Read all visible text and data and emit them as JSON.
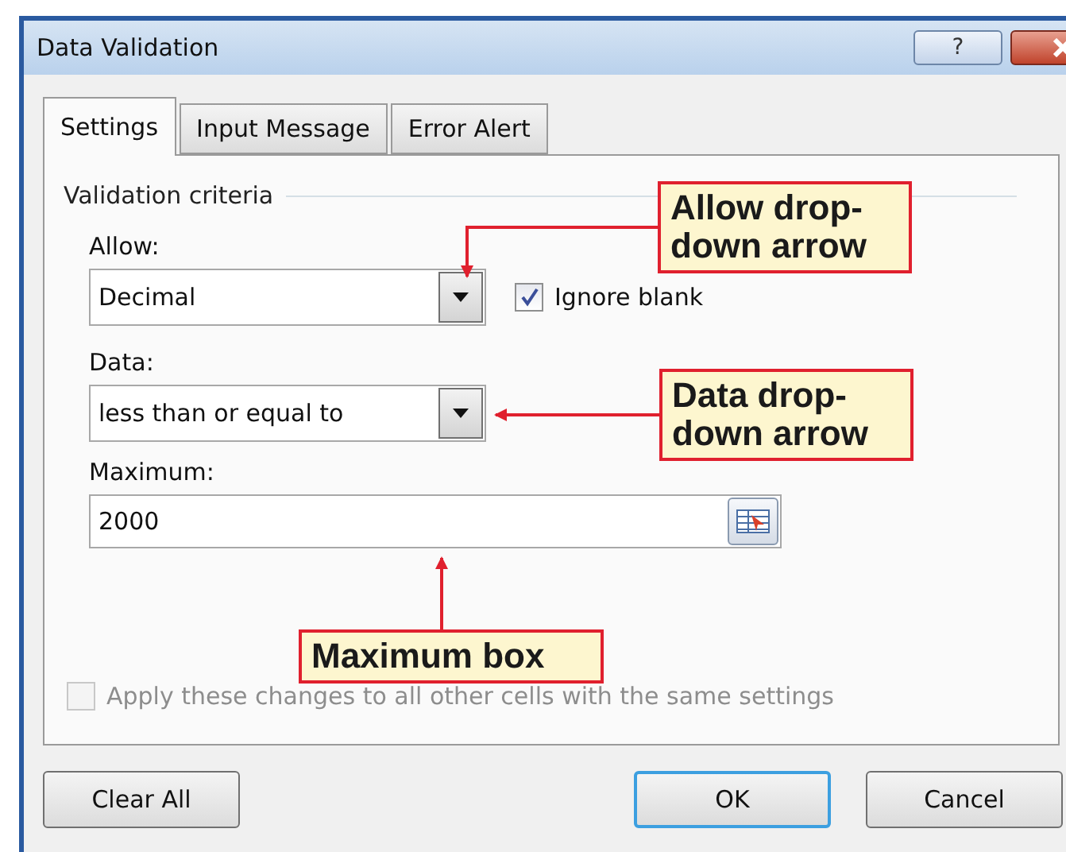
{
  "window": {
    "title": "Data Validation",
    "help": "?"
  },
  "tabs": [
    {
      "label": "Settings",
      "selected": true
    },
    {
      "label": "Input Message",
      "selected": false
    },
    {
      "label": "Error Alert",
      "selected": false
    }
  ],
  "group_title": "Validation criteria",
  "allow": {
    "label": "Allow:",
    "value": "Decimal"
  },
  "ignore_blank": {
    "label": "Ignore blank",
    "checked": true
  },
  "data": {
    "label": "Data:",
    "value": "less than or equal to"
  },
  "maximum": {
    "label": "Maximum:",
    "value": "2000"
  },
  "apply_all": {
    "label": "Apply these changes to all other cells with the same settings",
    "checked": false,
    "disabled": true
  },
  "buttons": [
    {
      "label": "Clear All",
      "default": false
    },
    {
      "label": "OK",
      "default": true
    },
    {
      "label": "Cancel",
      "default": false
    }
  ],
  "callouts": [
    {
      "text": "Allow drop-down arrow"
    },
    {
      "text": "Data drop-down arrow"
    },
    {
      "text": "Maximum box"
    }
  ]
}
